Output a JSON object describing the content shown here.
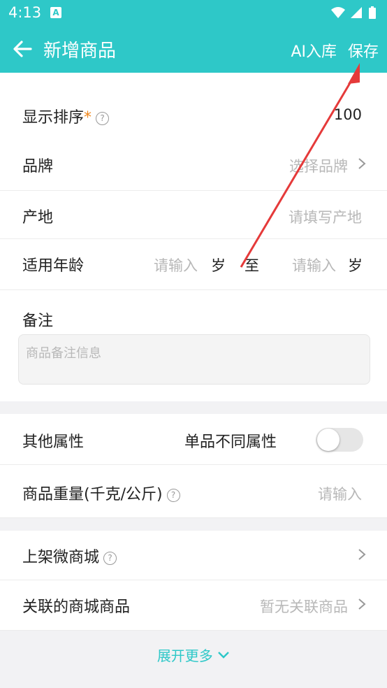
{
  "status": {
    "time": "4:13",
    "notif_icon_text": "A"
  },
  "appbar": {
    "title": "新增商品",
    "ai_label": "AI入库",
    "save_label": "保存"
  },
  "form": {
    "display_order": {
      "label": "显示排序",
      "required_mark": "*",
      "help": "?",
      "value": "100"
    },
    "brand": {
      "label": "品牌",
      "placeholder": "选择品牌"
    },
    "origin": {
      "label": "产地",
      "placeholder": "请填写产地"
    },
    "age": {
      "label": "适用年龄",
      "from_placeholder": "请输入",
      "from_unit": "岁",
      "separator": "至",
      "to_placeholder": "请输入",
      "to_unit": "岁"
    },
    "notes": {
      "label": "备注",
      "placeholder": "商品备注信息"
    },
    "other_attrs": {
      "label": "其他属性",
      "toggle_label": "单品不同属性",
      "toggle_on": false
    },
    "weight": {
      "label": "商品重量(千克/公斤)",
      "help": "?",
      "placeholder": "请输入"
    },
    "shop": {
      "label": "上架微商城",
      "help": "?"
    },
    "linked": {
      "label": "关联的商城商品",
      "value": "暂无关联商品"
    }
  },
  "expand": {
    "label": "展开更多"
  },
  "colors": {
    "accent": "#2ec8c8",
    "annotation_arrow": "#e53a3a"
  }
}
